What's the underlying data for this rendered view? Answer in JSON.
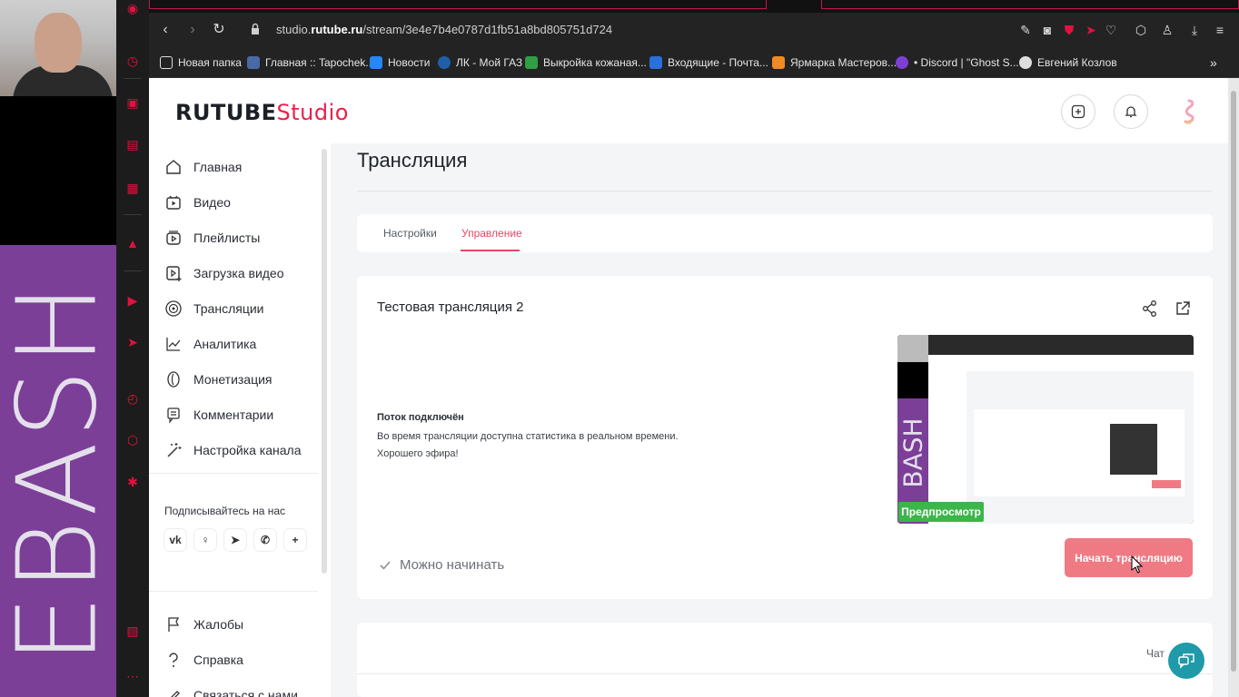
{
  "browser": {
    "url_prefix": "studio.",
    "url_domain": "rutube.ru",
    "url_path": "/stream/3e4e7b4e0787d1fb51a8bd805751d724",
    "bookmarks": [
      {
        "label": "Новая папка",
        "color": "#e0e0e0"
      },
      {
        "label": "Главная :: Tapochek...",
        "color": "#4a6aa5"
      },
      {
        "label": "Новости",
        "color": "#2787f5"
      },
      {
        "label": "ЛК - Мой ГАЗ",
        "color": "#1f5fa8"
      },
      {
        "label": "Выкройка кожаная...",
        "color": "#2f9e44"
      },
      {
        "label": "Входящие - Почта...",
        "color": "#2a6fdb"
      },
      {
        "label": "Ярмарка Мастеров...",
        "color": "#f08a24"
      },
      {
        "label": "• Discord | \"Ghost S...",
        "color": "#7e3fd6"
      },
      {
        "label": "Евгений Козлов",
        "color": "#dddddd"
      }
    ],
    "more_label": "»"
  },
  "overlay": {
    "bash_text": "EBASH"
  },
  "header": {
    "logo_main": "RUTUBE",
    "logo_studio": "Studio"
  },
  "sidebar": {
    "items": [
      {
        "label": "Главная",
        "icon": "home-icon"
      },
      {
        "label": "Видео",
        "icon": "video-icon"
      },
      {
        "label": "Плейлисты",
        "icon": "playlist-icon"
      },
      {
        "label": "Загрузка видео",
        "icon": "upload-icon"
      },
      {
        "label": "Трансляции",
        "icon": "broadcast-icon"
      },
      {
        "label": "Аналитика",
        "icon": "analytics-icon"
      },
      {
        "label": "Монетизация",
        "icon": "monetization-icon"
      },
      {
        "label": "Комментарии",
        "icon": "comments-icon"
      },
      {
        "label": "Настройка канала",
        "icon": "wand-icon"
      }
    ],
    "follow_label": "Подписывайтесь на нас",
    "social": [
      "vk",
      "ok",
      "tg",
      "viber",
      "+"
    ],
    "bottom_items": [
      {
        "label": "Жалобы",
        "icon": "flag-icon"
      },
      {
        "label": "Справка",
        "icon": "help-icon"
      },
      {
        "label": "Связаться с нами",
        "icon": "pen-icon"
      }
    ]
  },
  "main": {
    "title": "Трансляция",
    "tabs": [
      {
        "label": "Настройки",
        "active": false
      },
      {
        "label": "Управление",
        "active": true
      }
    ],
    "stream": {
      "title": "Тестовая трансляция 2",
      "status_head": "Поток подключён",
      "status_lines": [
        "Во время трансляции доступна статистика в реальном времени.",
        "Хорошего эфира!"
      ],
      "preview_label": "Предпросмотр",
      "ready_label": "Можно начинать",
      "start_button": "Начать трансляцию"
    },
    "chat_label": "Чат"
  },
  "colors": {
    "accent": "#e94663",
    "brand_red": "#e8214b",
    "start_button": "#f07a84",
    "preview_badge": "#3cb54a",
    "chat_fab": "#1e9aa8",
    "overlay_purple": "#7b3f98"
  }
}
